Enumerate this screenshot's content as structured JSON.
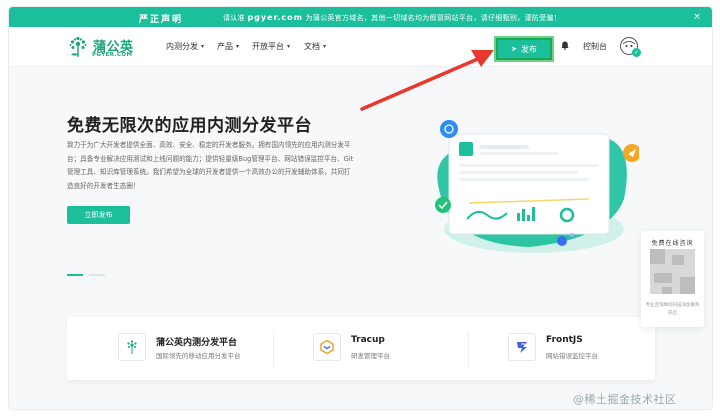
{
  "notice": {
    "strong": "严正声明",
    "prefix": "请认准",
    "url": "pgyer.com",
    "suffix": "为蒲公英官方域名，其他一切域名均为假冒网站平台，请仔细甄别，谨防受骗！",
    "close": "×"
  },
  "nav": {
    "logo_cn": "蒲公英",
    "logo_en": "PGYER.COM",
    "menus": [
      {
        "label": "内测分发"
      },
      {
        "label": "产品"
      },
      {
        "label": "开放平台"
      },
      {
        "label": "文档"
      }
    ],
    "caret": "▾",
    "publish_icon": "➤",
    "publish_label": "发布",
    "bell": "🔔",
    "console_label": "控制台",
    "avatar_badge": "✓"
  },
  "hero": {
    "title": "免费无限次的应用内测分发平台",
    "description": "致力于为广大开发者提供全面、高效、安全、稳定的开发者服务。拥有国内领先的应用内测分发平台；具备专业解决应用测试和上线问题的能力；提供轻量级Bug管理平台、网站错误监控平台、Git管理工具、知识库管理系统。我们希望为全球的开发者提供一个高效办公的开发辅助体系，共同打造良好的开发者生态圈！",
    "cta_label": "立即发布",
    "slide_count": 2,
    "active_slide": 1
  },
  "features": [
    {
      "name": "蒲公英内测分发平台",
      "subtitle": "国际领先的移动应用分发平台",
      "icon": "dandelion-icon"
    },
    {
      "name": "Tracup",
      "subtitle": "研发管理平台",
      "icon": "tracup-icon"
    },
    {
      "name": "FrontJS",
      "subtitle": "网站错误监控平台",
      "icon": "frontjs-icon"
    }
  ],
  "consult": {
    "title": "免费在线咨询",
    "note": "专业咨询顾问扫描添加服务开启"
  },
  "watermark": "@稀土掘金技术社区",
  "colors": {
    "brand": "#1bbf9c",
    "logo": "#1aa47c",
    "highlight_border": "#1fa651",
    "annotation_arrow": "#e8372d"
  }
}
